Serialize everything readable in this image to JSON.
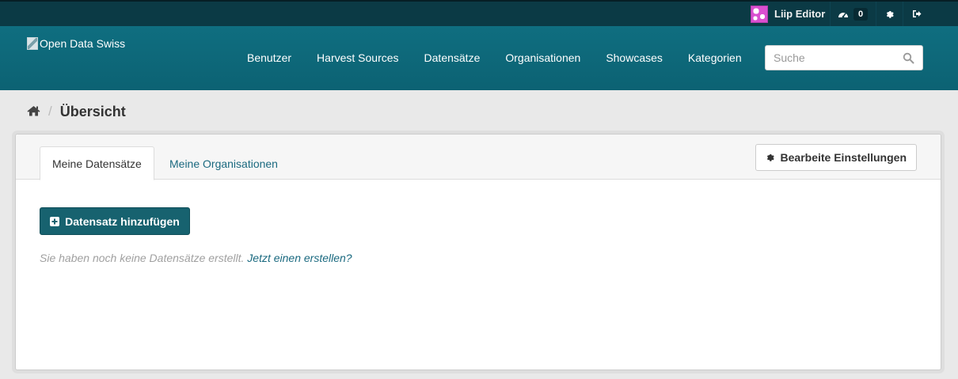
{
  "account": {
    "user_name": "Liip Editor",
    "dashboard_count": "0",
    "avatar_icon": "avatar-image",
    "dashboard_icon": "dashboard-icon",
    "settings_icon": "gear-icon",
    "logout_icon": "sign-out-icon"
  },
  "masthead": {
    "logo_alt": "Open Data Swiss",
    "nav": [
      "Benutzer",
      "Harvest Sources",
      "Datensätze",
      "Organisationen",
      "Showcases",
      "Kategorien"
    ],
    "search_placeholder": "Suche"
  },
  "breadcrumb": {
    "home_icon": "home-icon",
    "current": "Übersicht"
  },
  "dashboard": {
    "tabs": [
      "Meine Datensätze",
      "Meine Organisationen"
    ],
    "active_tab": "Meine Datensätze",
    "edit_settings_label": "Bearbeite Einstellungen",
    "add_dataset_label": "Datensatz hinzufügen",
    "empty_message": "Sie haben noch keine Datensätze erstellt.",
    "empty_link": "Jetzt einen erstellen?"
  },
  "colors": {
    "account_bar": "#0b3a45",
    "masthead": "#0f6c7e",
    "primary_button": "#17626f",
    "link": "#1b6a80"
  }
}
